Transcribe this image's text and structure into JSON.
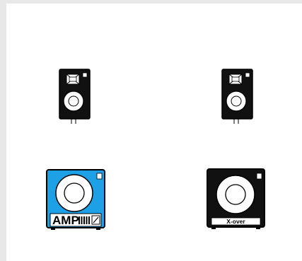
{
  "devices": [
    {
      "id": "speaker-left",
      "type": "speaker"
    },
    {
      "id": "speaker-right",
      "type": "speaker"
    },
    {
      "id": "amplifier",
      "type": "amplifier",
      "label": "AMP",
      "color": "#1ea0e6"
    },
    {
      "id": "crossover",
      "type": "crossover",
      "label": "X-over",
      "color": "#111111"
    }
  ]
}
